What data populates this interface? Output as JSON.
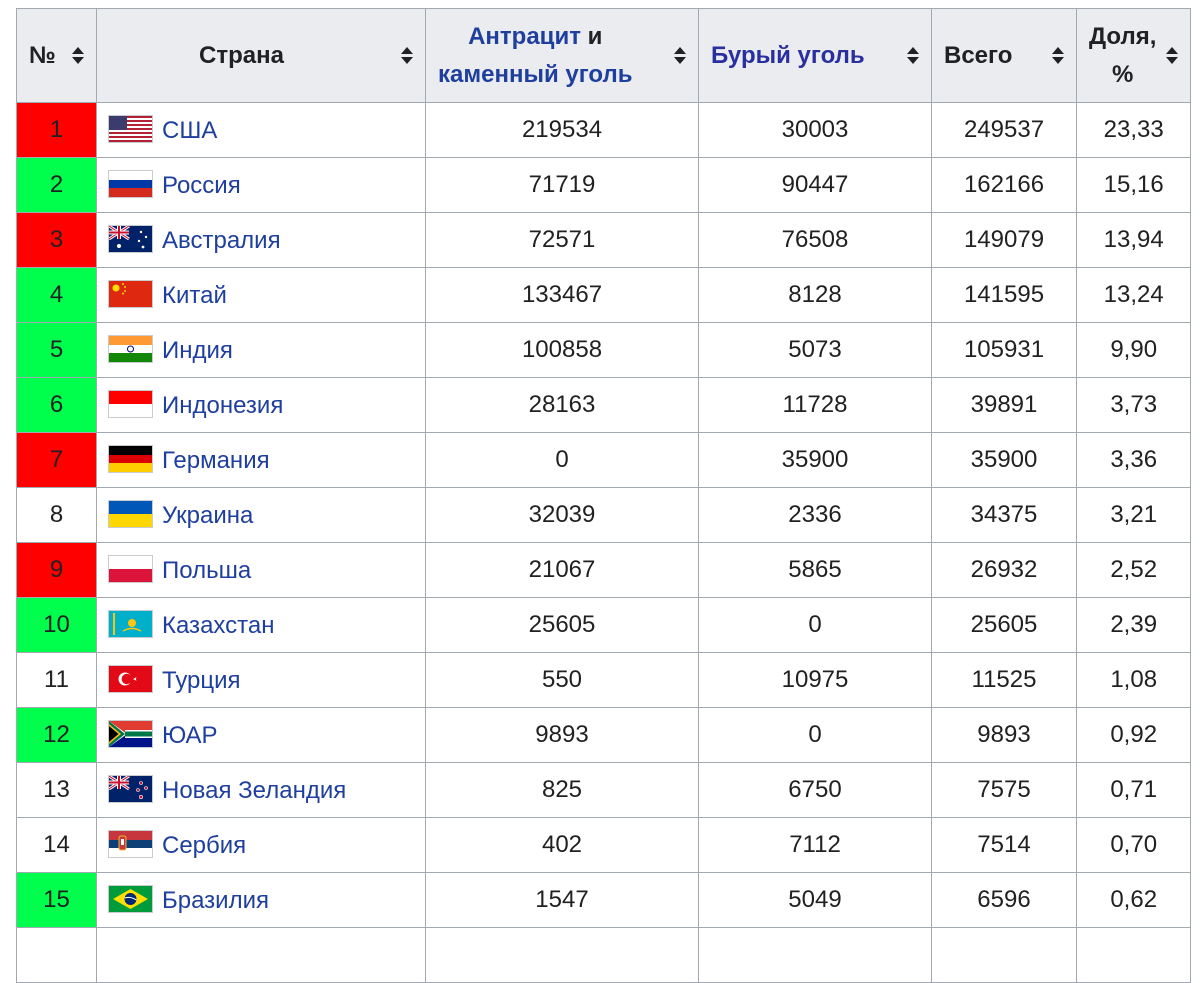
{
  "headers": {
    "rank": "№",
    "country": "Страна",
    "anthracite_link": "Антрацит",
    "anthracite_rest": " и",
    "anthracite_line2": "каменный уголь",
    "lignite": "Бурый уголь",
    "total": "Всего",
    "share_line1": "Доля,",
    "share_line2": "%"
  },
  "colors": {
    "rank_red": "#ff0000",
    "rank_green": "#00ff4d",
    "link": "#1f3f9e",
    "header_bg": "#eaecf0",
    "border": "#a2a9b1"
  },
  "rows": [
    {
      "rank": "1",
      "rank_color": "red",
      "flag": "usa-flag-icon",
      "country": "США",
      "anthracite": "219534",
      "lignite": "30003",
      "total": "249537",
      "share": "23,33"
    },
    {
      "rank": "2",
      "rank_color": "green",
      "flag": "russia-flag-icon",
      "country": "Россия",
      "anthracite": "71719",
      "lignite": "90447",
      "total": "162166",
      "share": "15,16"
    },
    {
      "rank": "3",
      "rank_color": "red",
      "flag": "australia-flag-icon",
      "country": "Австралия",
      "anthracite": "72571",
      "lignite": "76508",
      "total": "149079",
      "share": "13,94"
    },
    {
      "rank": "4",
      "rank_color": "green",
      "flag": "china-flag-icon",
      "country": "Китай",
      "anthracite": "133467",
      "lignite": "8128",
      "total": "141595",
      "share": "13,24"
    },
    {
      "rank": "5",
      "rank_color": "green",
      "flag": "india-flag-icon",
      "country": "Индия",
      "anthracite": "100858",
      "lignite": "5073",
      "total": "105931",
      "share": "9,90"
    },
    {
      "rank": "6",
      "rank_color": "green",
      "flag": "indonesia-flag-icon",
      "country": "Индонезия",
      "anthracite": "28163",
      "lignite": "11728",
      "total": "39891",
      "share": "3,73"
    },
    {
      "rank": "7",
      "rank_color": "red",
      "flag": "germany-flag-icon",
      "country": "Германия",
      "anthracite": "0",
      "lignite": "35900",
      "total": "35900",
      "share": "3,36"
    },
    {
      "rank": "8",
      "rank_color": "none",
      "flag": "ukraine-flag-icon",
      "country": "Украина",
      "anthracite": "32039",
      "lignite": "2336",
      "total": "34375",
      "share": "3,21"
    },
    {
      "rank": "9",
      "rank_color": "red",
      "flag": "poland-flag-icon",
      "country": "Польша",
      "anthracite": "21067",
      "lignite": "5865",
      "total": "26932",
      "share": "2,52"
    },
    {
      "rank": "10",
      "rank_color": "green",
      "flag": "kazakhstan-flag-icon",
      "country": "Казахстан",
      "anthracite": "25605",
      "lignite": "0",
      "total": "25605",
      "share": "2,39"
    },
    {
      "rank": "11",
      "rank_color": "none",
      "flag": "turkey-flag-icon",
      "country": "Турция",
      "anthracite": "550",
      "lignite": "10975",
      "total": "11525",
      "share": "1,08"
    },
    {
      "rank": "12",
      "rank_color": "green",
      "flag": "south-africa-flag-icon",
      "country": "ЮАР",
      "anthracite": "9893",
      "lignite": "0",
      "total": "9893",
      "share": "0,92"
    },
    {
      "rank": "13",
      "rank_color": "none",
      "flag": "new-zealand-flag-icon",
      "country": "Новая Зеландия",
      "anthracite": "825",
      "lignite": "6750",
      "total": "7575",
      "share": "0,71"
    },
    {
      "rank": "14",
      "rank_color": "none",
      "flag": "serbia-flag-icon",
      "country": "Сербия",
      "anthracite": "402",
      "lignite": "7112",
      "total": "7514",
      "share": "0,70"
    },
    {
      "rank": "15",
      "rank_color": "green",
      "flag": "brazil-flag-icon",
      "country": "Бразилия",
      "anthracite": "1547",
      "lignite": "5049",
      "total": "6596",
      "share": "0,62"
    }
  ]
}
